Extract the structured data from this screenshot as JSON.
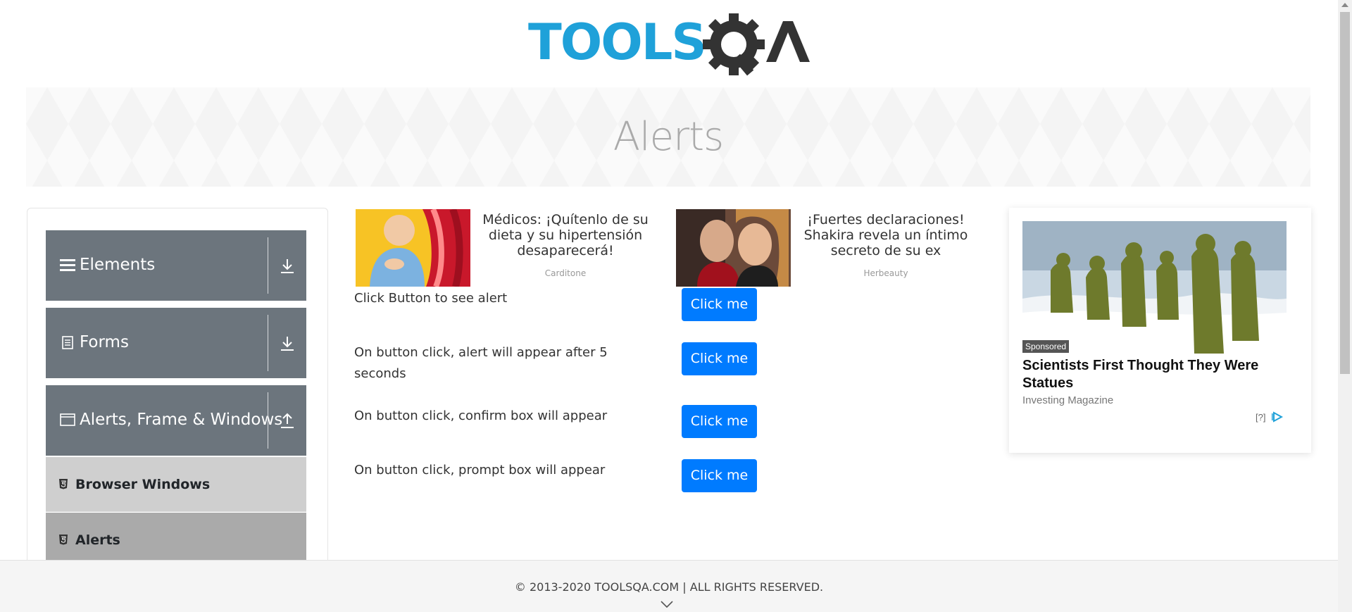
{
  "logo": {
    "text_part1": "TOOLS",
    "text_part2": "QA"
  },
  "banner": {
    "title": "Alerts"
  },
  "sidebar": {
    "groups": [
      {
        "label": "Elements",
        "icon": "hamburger-icon",
        "expanded": false
      },
      {
        "label": "Forms",
        "icon": "document-icon",
        "expanded": false
      },
      {
        "label": "Alerts, Frame & Windows",
        "icon": "window-icon",
        "expanded": true
      }
    ],
    "items": [
      {
        "label": "Browser Windows",
        "icon": "html5-icon"
      },
      {
        "label": "Alerts",
        "icon": "html5-icon",
        "active": true
      }
    ]
  },
  "ads": [
    {
      "headline": "Médicos: ¡Quítenlo de su dieta y su hipertensión desaparecerá!",
      "source": "Carditone"
    },
    {
      "headline": "¡Fuertes declaraciones! Shakira revela un íntimo secreto de su ex",
      "source": "Herbeauty"
    }
  ],
  "alerts": [
    {
      "text": "Click Button to see alert",
      "button": "Click me"
    },
    {
      "text": "On button click, alert will appear after 5 seconds",
      "button": "Click me"
    },
    {
      "text": "On button click, confirm box will appear",
      "button": "Click me"
    },
    {
      "text": "On button click, prompt box will appear",
      "button": "Click me"
    }
  ],
  "sponsored": {
    "tag": "Sponsored",
    "title": "Scientists First Thought They Were Statues",
    "source": "Investing Magazine",
    "info": "[?]"
  },
  "footer": {
    "copyright": "© 2013-2020 TOOLSQA.COM | ALL RIGHTS RESERVED."
  },
  "colors": {
    "primary_button": "#007bff",
    "sidebar_group": "#6c757d",
    "logo_blue": "#1fa1d9",
    "logo_dark": "#333333"
  }
}
